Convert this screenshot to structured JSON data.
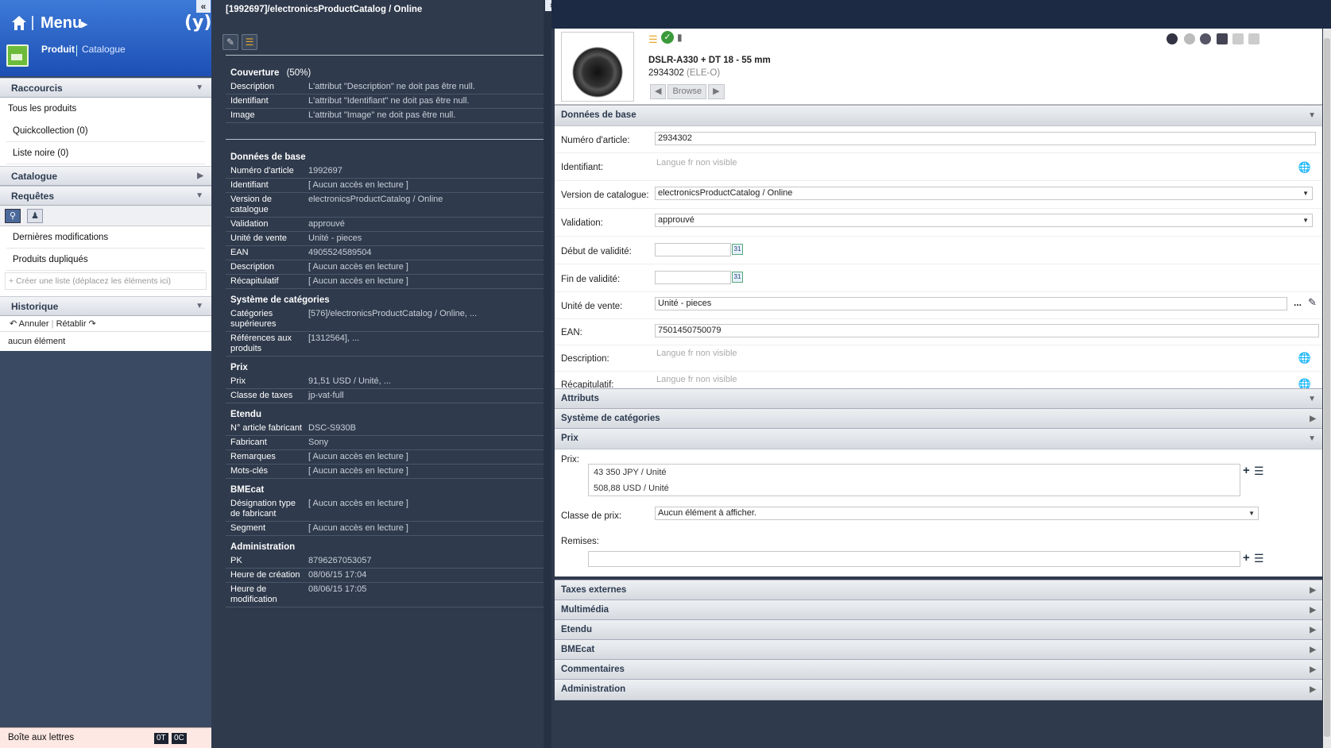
{
  "menu": {
    "title": "Menu",
    "product_tab": "Produit",
    "catalog_tab": "Catalogue"
  },
  "sidebar": {
    "shortcuts": {
      "title": "Raccourcis",
      "all_products": "Tous les produits",
      "quickcollection": "Quickcollection (0)",
      "blacklist": "Liste noire (0)"
    },
    "catalogue": {
      "title": "Catalogue"
    },
    "queries": {
      "title": "Requêtes",
      "items": [
        "Dernières modifications",
        "Produits dupliqués"
      ],
      "create_hint": "+ Créer une liste (déplacez les éléments ici)"
    },
    "history": {
      "title": "Historique",
      "undo": "Annuler",
      "redo": "Rétablir",
      "empty": "aucun élément"
    },
    "mailbox": {
      "label": "Boîte aux lettres",
      "count_a": "0T",
      "count_b": "0C"
    }
  },
  "middle": {
    "breadcrumb": "[1992697]/electronicsProductCatalog / Online",
    "coverage": {
      "title": "Couverture",
      "percent": "(50%)",
      "rows": [
        {
          "k": "Description",
          "v": "L'attribut \"Description\" ne doit pas être null."
        },
        {
          "k": "Identifiant",
          "v": "L'attribut \"Identifiant\" ne doit pas être null."
        },
        {
          "k": "Image",
          "v": "L'attribut \"Image\" ne doit pas être null."
        }
      ]
    },
    "sections": [
      {
        "title": "Données de base",
        "rows": [
          {
            "k": "Numéro d'article",
            "v": "1992697"
          },
          {
            "k": "Identifiant",
            "v": "[ Aucun accès en lecture ]"
          },
          {
            "k": "Version de catalogue",
            "v": "electronicsProductCatalog / Online"
          },
          {
            "k": "Validation",
            "v": "approuvé"
          },
          {
            "k": "Unité de vente",
            "v": "Unité - pieces"
          },
          {
            "k": "EAN",
            "v": "4905524589504"
          },
          {
            "k": "Description",
            "v": "[ Aucun accès en lecture ]"
          },
          {
            "k": "Récapitulatif",
            "v": "[ Aucun accès en lecture ]"
          }
        ]
      },
      {
        "title": "Système de catégories",
        "rows": [
          {
            "k": "Catégories supérieures",
            "v": "[576]/electronicsProductCatalog / Online, ..."
          },
          {
            "k": "Références aux produits",
            "v": "[1312564], ..."
          }
        ]
      },
      {
        "title": "Prix",
        "rows": [
          {
            "k": "Prix",
            "v": "91,51 USD / Unité, ..."
          },
          {
            "k": "Classe de taxes",
            "v": "jp-vat-full"
          }
        ]
      },
      {
        "title": "Etendu",
        "rows": [
          {
            "k": "N° article fabricant",
            "v": "DSC-S930B"
          },
          {
            "k": "Fabricant",
            "v": "Sony"
          },
          {
            "k": "Remarques",
            "v": "[ Aucun accès en lecture ]"
          },
          {
            "k": "Mots-clés",
            "v": "[ Aucun accès en lecture ]"
          }
        ]
      },
      {
        "title": "BMEcat",
        "rows": [
          {
            "k": "Désignation type de fabricant",
            "v": "[ Aucun accès en lecture ]"
          },
          {
            "k": "Segment",
            "v": "[ Aucun accès en lecture ]"
          }
        ]
      },
      {
        "title": "Administration",
        "rows": [
          {
            "k": "PK",
            "v": "8796267053057"
          },
          {
            "k": "Heure de création",
            "v": "08/06/15 17:04"
          },
          {
            "k": "Heure de modification",
            "v": "08/06/15 17:05"
          }
        ]
      }
    ]
  },
  "product": {
    "title": "DSLR-A330 + DT 18 - 55 mm",
    "number": "2934302",
    "number_suffix": "(ELE-O)",
    "browse": "Browse"
  },
  "editor": {
    "base": {
      "title": "Données de base",
      "article_label": "Numéro d'article:",
      "article_value": "2934302",
      "identifier_label": "Identifiant:",
      "identifier_placeholder": "Langue fr non visible",
      "catalog_label": "Version de catalogue:",
      "catalog_value": "electronicsProductCatalog / Online",
      "validation_label": "Validation:",
      "validation_value": "approuvé",
      "start_label": "Début de validité:",
      "end_label": "Fin de validité:",
      "unit_label": "Unité de vente:",
      "unit_value": "Unité - pieces",
      "ean_label": "EAN:",
      "ean_value": "7501450750079",
      "desc_label": "Description:",
      "desc_placeholder": "Langue fr non visible",
      "summary_label": "Récapitulatif:",
      "summary_placeholder": "Langue fr non visible"
    },
    "attributes": "Attributs",
    "categories": "Système de catégories",
    "prices": {
      "title": "Prix",
      "prices_label": "Prix:",
      "price_items": [
        "43 350 JPY / Unité",
        "508,88 USD / Unité"
      ],
      "class_label": "Classe de prix:",
      "class_value": "Aucun élément à afficher.",
      "discounts_label": "Remises:"
    },
    "external_taxes": "Taxes externes",
    "multimedia": "Multimédia",
    "extended": "Etendu",
    "bmecat": "BMEcat",
    "comments": "Commentaires",
    "administration": "Administration"
  },
  "colors": {
    "header_blue": "#1d4fb4",
    "dark_panel": "#2f3a4c",
    "accent_green": "#6dbb3a"
  }
}
